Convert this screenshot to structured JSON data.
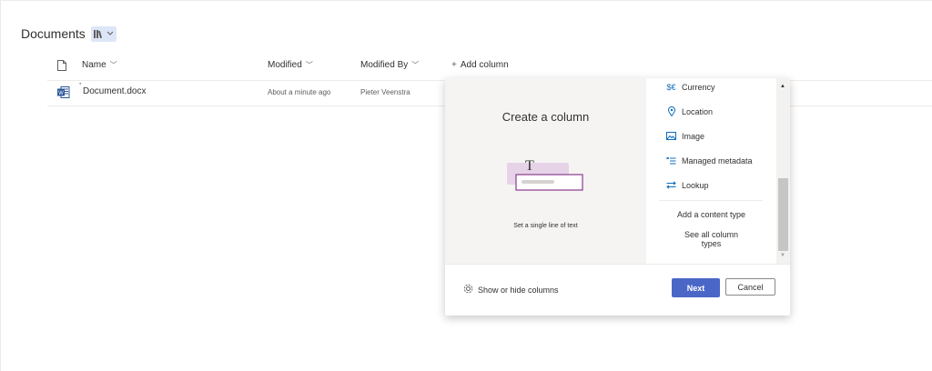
{
  "library": {
    "title": "Documents",
    "switch_icon": "library-icon"
  },
  "columns": {
    "name": "Name",
    "modified": "Modified",
    "modified_by": "Modified By",
    "add_column": "Add column"
  },
  "rows": [
    {
      "file_icon": "word-file-icon",
      "name": "Document.docx",
      "modified": "About a minute ago",
      "modified_by": "Pieter Veenstra"
    }
  ],
  "dialog": {
    "title": "Create a column",
    "caption": "Set a single line of text",
    "types": [
      {
        "label": "Currency",
        "icon": "currency-icon"
      },
      {
        "label": "Location",
        "icon": "location-pin-icon"
      },
      {
        "label": "Image",
        "icon": "image-icon"
      },
      {
        "label": "Managed metadata",
        "icon": "tag-list-icon"
      },
      {
        "label": "Lookup",
        "icon": "lookup-arrows-icon"
      }
    ],
    "add_content_type": "Add a content type",
    "see_all_line1": "See all column",
    "see_all_line2": "types",
    "show_hide": "Show or hide columns",
    "next": "Next",
    "cancel": "Cancel"
  },
  "colors": {
    "primary": "#4a66c7",
    "accent_icon": "#0f6cbd",
    "preview_bg": "#f5f4f3",
    "illustration_purple": "#8a3b8f"
  }
}
